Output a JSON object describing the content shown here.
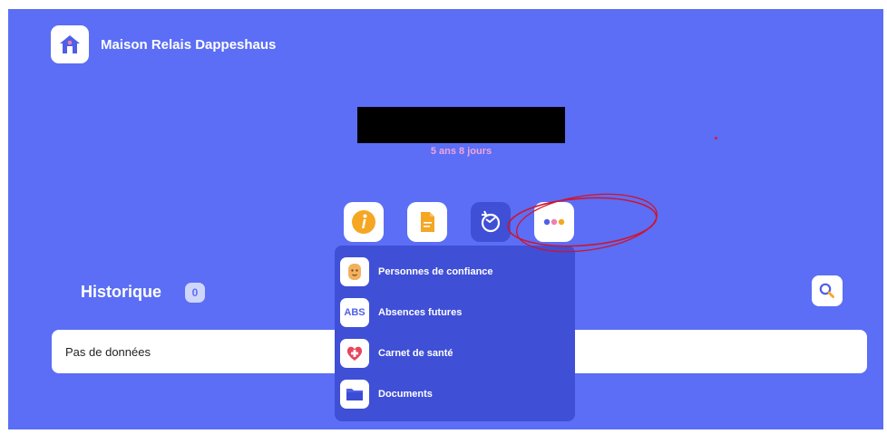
{
  "brand": {
    "name": "Maison Relais Dappeshaus",
    "icon": "house-icon"
  },
  "profile": {
    "age": "5 ans 8 jours"
  },
  "actions": [
    {
      "icon": "info-icon"
    },
    {
      "icon": "document-icon"
    },
    {
      "icon": "refresh-icon"
    },
    {
      "icon": "more-icon"
    }
  ],
  "menu": {
    "items": [
      {
        "label": "Personnes de confiance",
        "icon": "person-icon"
      },
      {
        "label": "Absences futures",
        "icon": "abs-icon",
        "icon_text": "ABS"
      },
      {
        "label": "Carnet de santé",
        "icon": "health-icon"
      },
      {
        "label": "Documents",
        "icon": "folder-icon"
      }
    ]
  },
  "history": {
    "title": "Historique",
    "count": "0",
    "empty": "Pas de données"
  },
  "colors": {
    "primary": "#5b6ef5",
    "menu": "#3f4fd6",
    "age": "#f0a6df",
    "annotation": "#d0142c"
  }
}
